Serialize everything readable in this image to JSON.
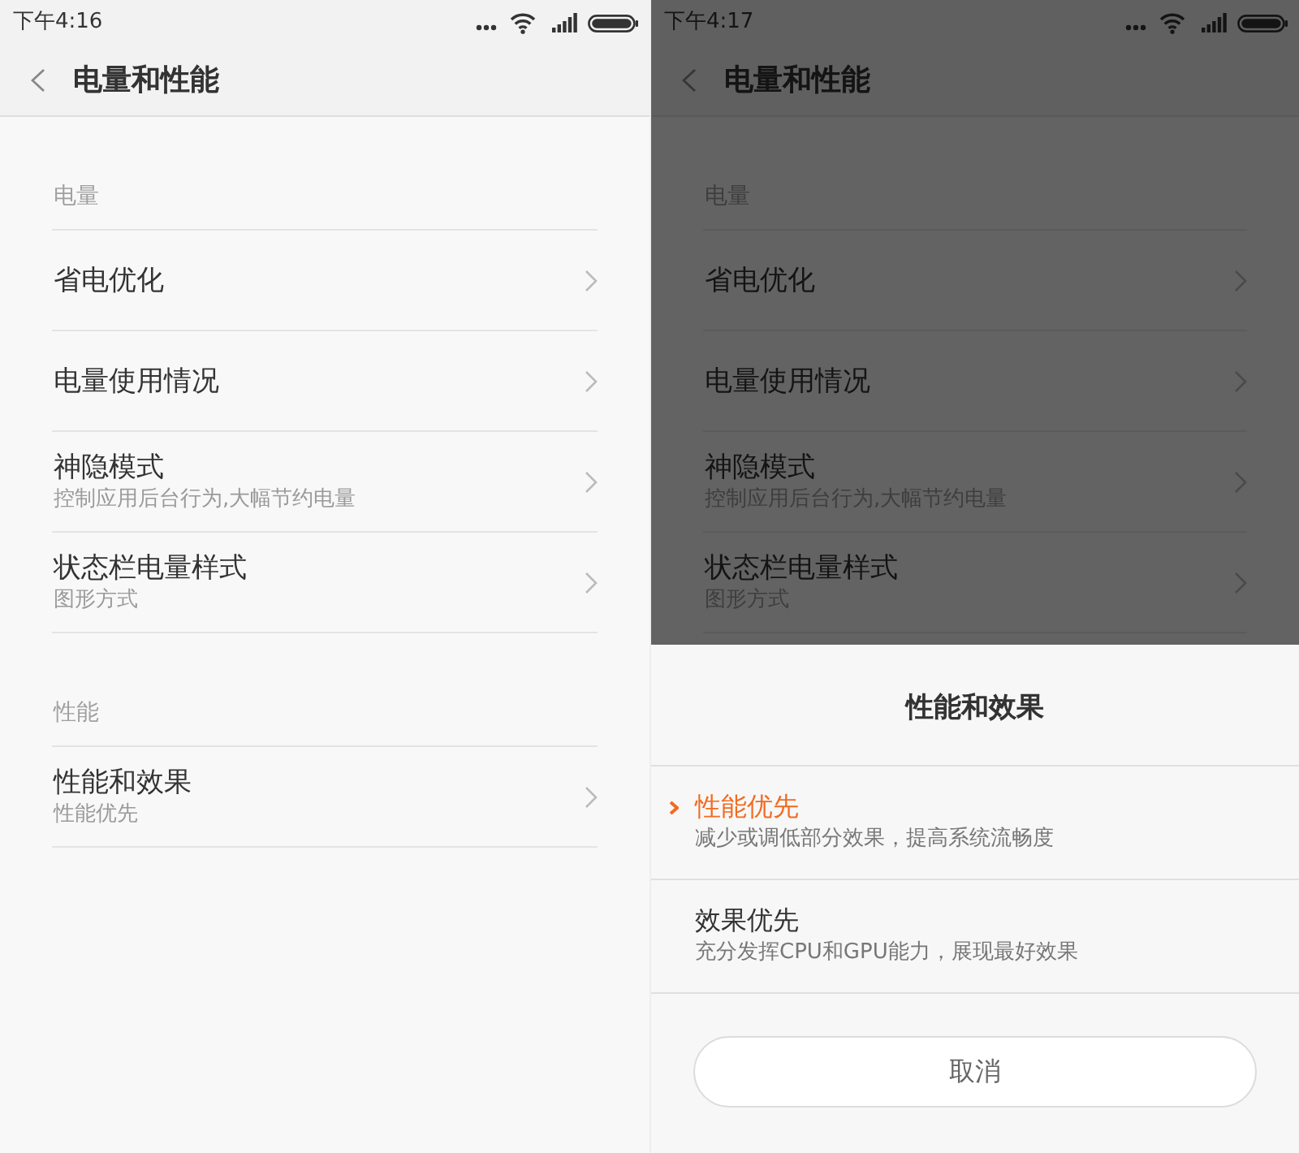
{
  "screens": [
    {
      "dimmed": false,
      "status_bar": {
        "time": "下午4:16"
      },
      "header": {
        "title": "电量和性能"
      },
      "sections": [
        {
          "label": "电量",
          "items": [
            {
              "title": "省电优化"
            },
            {
              "title": "电量使用情况"
            },
            {
              "title": "神隐模式",
              "subtitle": "控制应用后台行为,大幅节约电量"
            },
            {
              "title": "状态栏电量样式",
              "subtitle": "图形方式"
            }
          ]
        },
        {
          "label": "性能",
          "items": [
            {
              "title": "性能和效果",
              "subtitle": "性能优先"
            }
          ]
        }
      ]
    },
    {
      "dimmed": true,
      "status_bar": {
        "time": "下午4:17"
      },
      "header": {
        "title": "电量和性能"
      },
      "sections": [
        {
          "label": "电量",
          "items": [
            {
              "title": "省电优化"
            },
            {
              "title": "电量使用情况"
            },
            {
              "title": "神隐模式",
              "subtitle": "控制应用后台行为,大幅节约电量"
            },
            {
              "title": "状态栏电量样式",
              "subtitle": "图形方式"
            }
          ]
        }
      ],
      "bottom_sheet": {
        "title": "性能和效果",
        "options": [
          {
            "title": "性能优先",
            "subtitle": "减少或调低部分效果，提高系统流畅度",
            "selected": true
          },
          {
            "title": "效果优先",
            "subtitle": "充分发挥CPU和GPU能力，展现最好效果",
            "selected": false
          }
        ],
        "cancel_button": "取消"
      }
    }
  ]
}
